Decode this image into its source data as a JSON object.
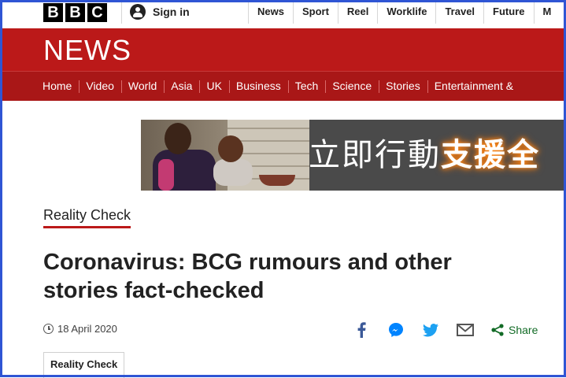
{
  "header": {
    "logo_letters": [
      "B",
      "B",
      "C"
    ],
    "sign_in_label": "Sign in",
    "top_nav": [
      "News",
      "Sport",
      "Reel",
      "Worklife",
      "Travel",
      "Future",
      "M"
    ]
  },
  "news_banner": {
    "title": "NEWS"
  },
  "section_nav": [
    "Home",
    "Video",
    "World",
    "Asia",
    "UK",
    "Business",
    "Tech",
    "Science",
    "Stories",
    "Entertainment &"
  ],
  "ad": {
    "text_plain": "立即行動",
    "text_highlight": "支援全"
  },
  "article": {
    "section_link": "Reality Check",
    "headline": "Coronavirus: BCG rumours and other stories fact-checked",
    "date": "18 April 2020",
    "share_label": "Share",
    "share_icons": [
      "facebook-icon",
      "messenger-icon",
      "twitter-icon",
      "email-icon",
      "share-icon"
    ],
    "tag": "Reality Check"
  },
  "colors": {
    "brand_red": "#bb1919",
    "nav_red": "#a91717",
    "share_green": "#126b26",
    "facebook_blue": "#3b5998",
    "messenger_blue": "#0084ff",
    "twitter_blue": "#1da1f2",
    "frame_blue": "#2f55d4"
  }
}
